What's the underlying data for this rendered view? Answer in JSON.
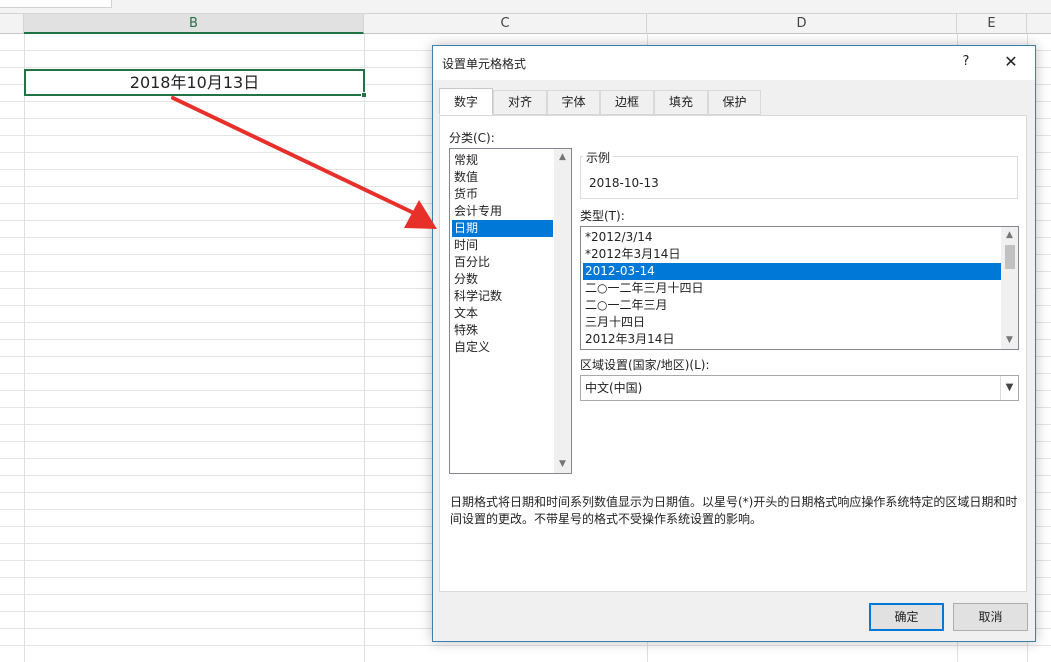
{
  "sheet": {
    "columns": [
      "B",
      "C",
      "D",
      "E"
    ],
    "selected_column": "B",
    "selected_cell_value": "2018年10月13日",
    "arrow_color": "#e8302b"
  },
  "dialog": {
    "title": "设置单元格格式",
    "help_label": "?",
    "close_label": "✕",
    "tabs": [
      "数字",
      "对齐",
      "字体",
      "边框",
      "填充",
      "保护"
    ],
    "active_tab": "数字",
    "category_label": "分类(C):",
    "categories": [
      "常规",
      "数值",
      "货币",
      "会计专用",
      "日期",
      "时间",
      "百分比",
      "分数",
      "科学记数",
      "文本",
      "特殊",
      "自定义"
    ],
    "selected_category": "日期",
    "sample_label": "示例",
    "sample_value": "2018-10-13",
    "type_label": "类型(T):",
    "types": [
      "*2012/3/14",
      "*2012年3月14日",
      "2012-03-14",
      "二○一二年三月十四日",
      "二○一二年三月",
      "三月十四日",
      "2012年3月14日"
    ],
    "selected_type": "2012-03-14",
    "locale_label": "区域设置(国家/地区)(L):",
    "locale_value": "中文(中国)",
    "description": "日期格式将日期和时间系列数值显示为日期值。以星号(*)开头的日期格式响应操作系统特定的区域日期和时间设置的更改。不带星号的格式不受操作系统设置的影响。",
    "ok_label": "确定",
    "cancel_label": "取消"
  }
}
